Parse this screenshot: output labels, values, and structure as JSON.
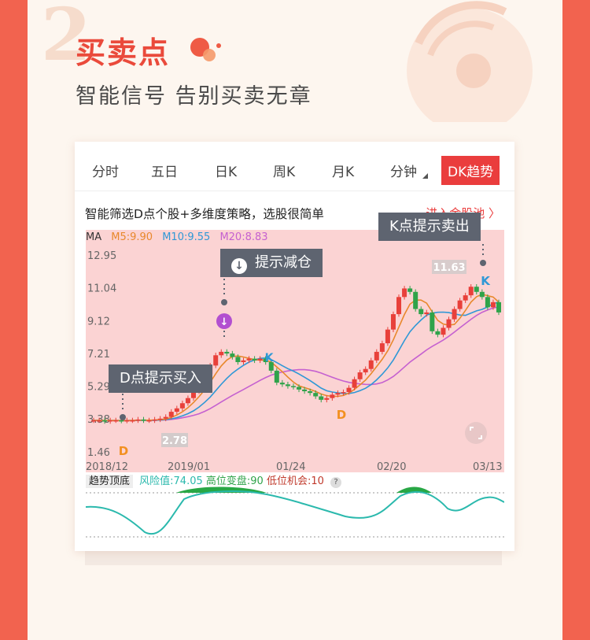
{
  "header": {
    "section_number": "2",
    "title": "买卖点",
    "subtitle": "智能信号  告别买卖无章"
  },
  "tabs": [
    {
      "label": "分时"
    },
    {
      "label": "五日"
    },
    {
      "label": "日K"
    },
    {
      "label": "周K"
    },
    {
      "label": "月K"
    },
    {
      "label": "分钟"
    },
    {
      "label": "DK趋势",
      "active": true
    }
  ],
  "promo": {
    "text": "智能筛选D点个股+多维度策略，选股很简单",
    "link": "进入金股池 〉"
  },
  "legend": {
    "ma": "MA",
    "ma5": "M5:9.90",
    "ma10": "M10:9.55",
    "ma20": "M20:8.83"
  },
  "callouts": {
    "sell": "K点提示卖出",
    "reduce": "提示减仓",
    "buy": "D点提示买入"
  },
  "chart_data": {
    "type": "candlestick",
    "y_ticks": [
      "12.95",
      "11.04",
      "9.12",
      "7.21",
      "5.29",
      "3.38",
      "1.46"
    ],
    "x_ticks": [
      "2018/12",
      "2019/01",
      "01/24",
      "02/20",
      "03/13"
    ],
    "price_labels": {
      "high": "11.63",
      "low": "2.78"
    },
    "signals": [
      "D",
      "K",
      "D",
      "K"
    ],
    "ylim": [
      1.46,
      12.95
    ]
  },
  "indicator": {
    "name": "趋势顶底",
    "risk": "风险值:74.05",
    "high_change": "高位变盘:90",
    "low_chance": "低位机会:10",
    "help": "?"
  },
  "colors": {
    "accent": "#ea3d3d",
    "ma5": "#e8882c",
    "ma10": "#2f98d6",
    "ma20": "#c561d0",
    "up": "#e8403a",
    "down": "#2fa34a",
    "indicator_line": "#2bb9ad"
  }
}
